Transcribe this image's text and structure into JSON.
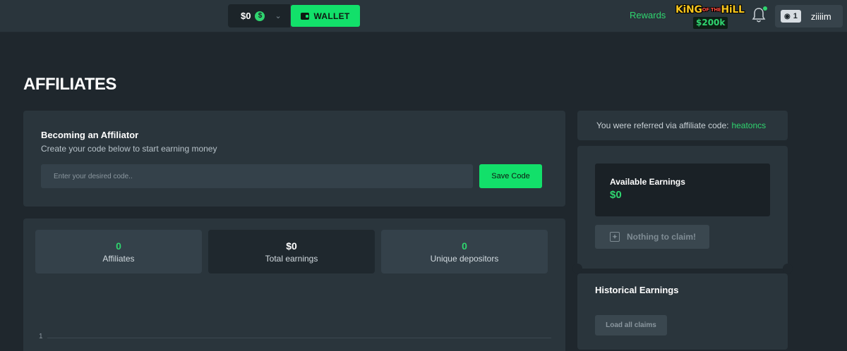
{
  "header": {
    "balance": "$0",
    "currency_symbol": "$",
    "wallet_label": "WALLET",
    "rewards_label": "Rewards",
    "event_logo": {
      "line1_a": "KiNG",
      "line1_of": "OF THE",
      "line1_b": "HiLL",
      "prize": "$200k"
    },
    "user_level": "1",
    "username": "ziiiim",
    "notification_dot_color": "#2fd56f"
  },
  "page": {
    "title": "AFFILIATES"
  },
  "affiliator": {
    "title": "Becoming an Affiliator",
    "subtitle": "Create your code below to start earning money",
    "input_placeholder": "Enter your desired code..",
    "input_value": "",
    "save_label": "Save Code"
  },
  "stats": [
    {
      "value": "0",
      "label": "Affiliates"
    },
    {
      "value": "$0",
      "label": "Total earnings"
    },
    {
      "value": "0",
      "label": "Unique depositors"
    }
  ],
  "chart": {
    "y_tick": "1"
  },
  "referral": {
    "text": "You were referred via affiliate code:",
    "code": "heatoncs"
  },
  "earnings": {
    "available_title": "Available Earnings",
    "available_value": "$0",
    "claim_label": "Nothing to claim!"
  },
  "historical": {
    "title": "Historical Earnings",
    "load_label": "Load all claims"
  },
  "colors": {
    "accent": "#12e06a",
    "accent_text": "#2fd56f",
    "background": "#1f272d",
    "panel": "#2a353c"
  }
}
